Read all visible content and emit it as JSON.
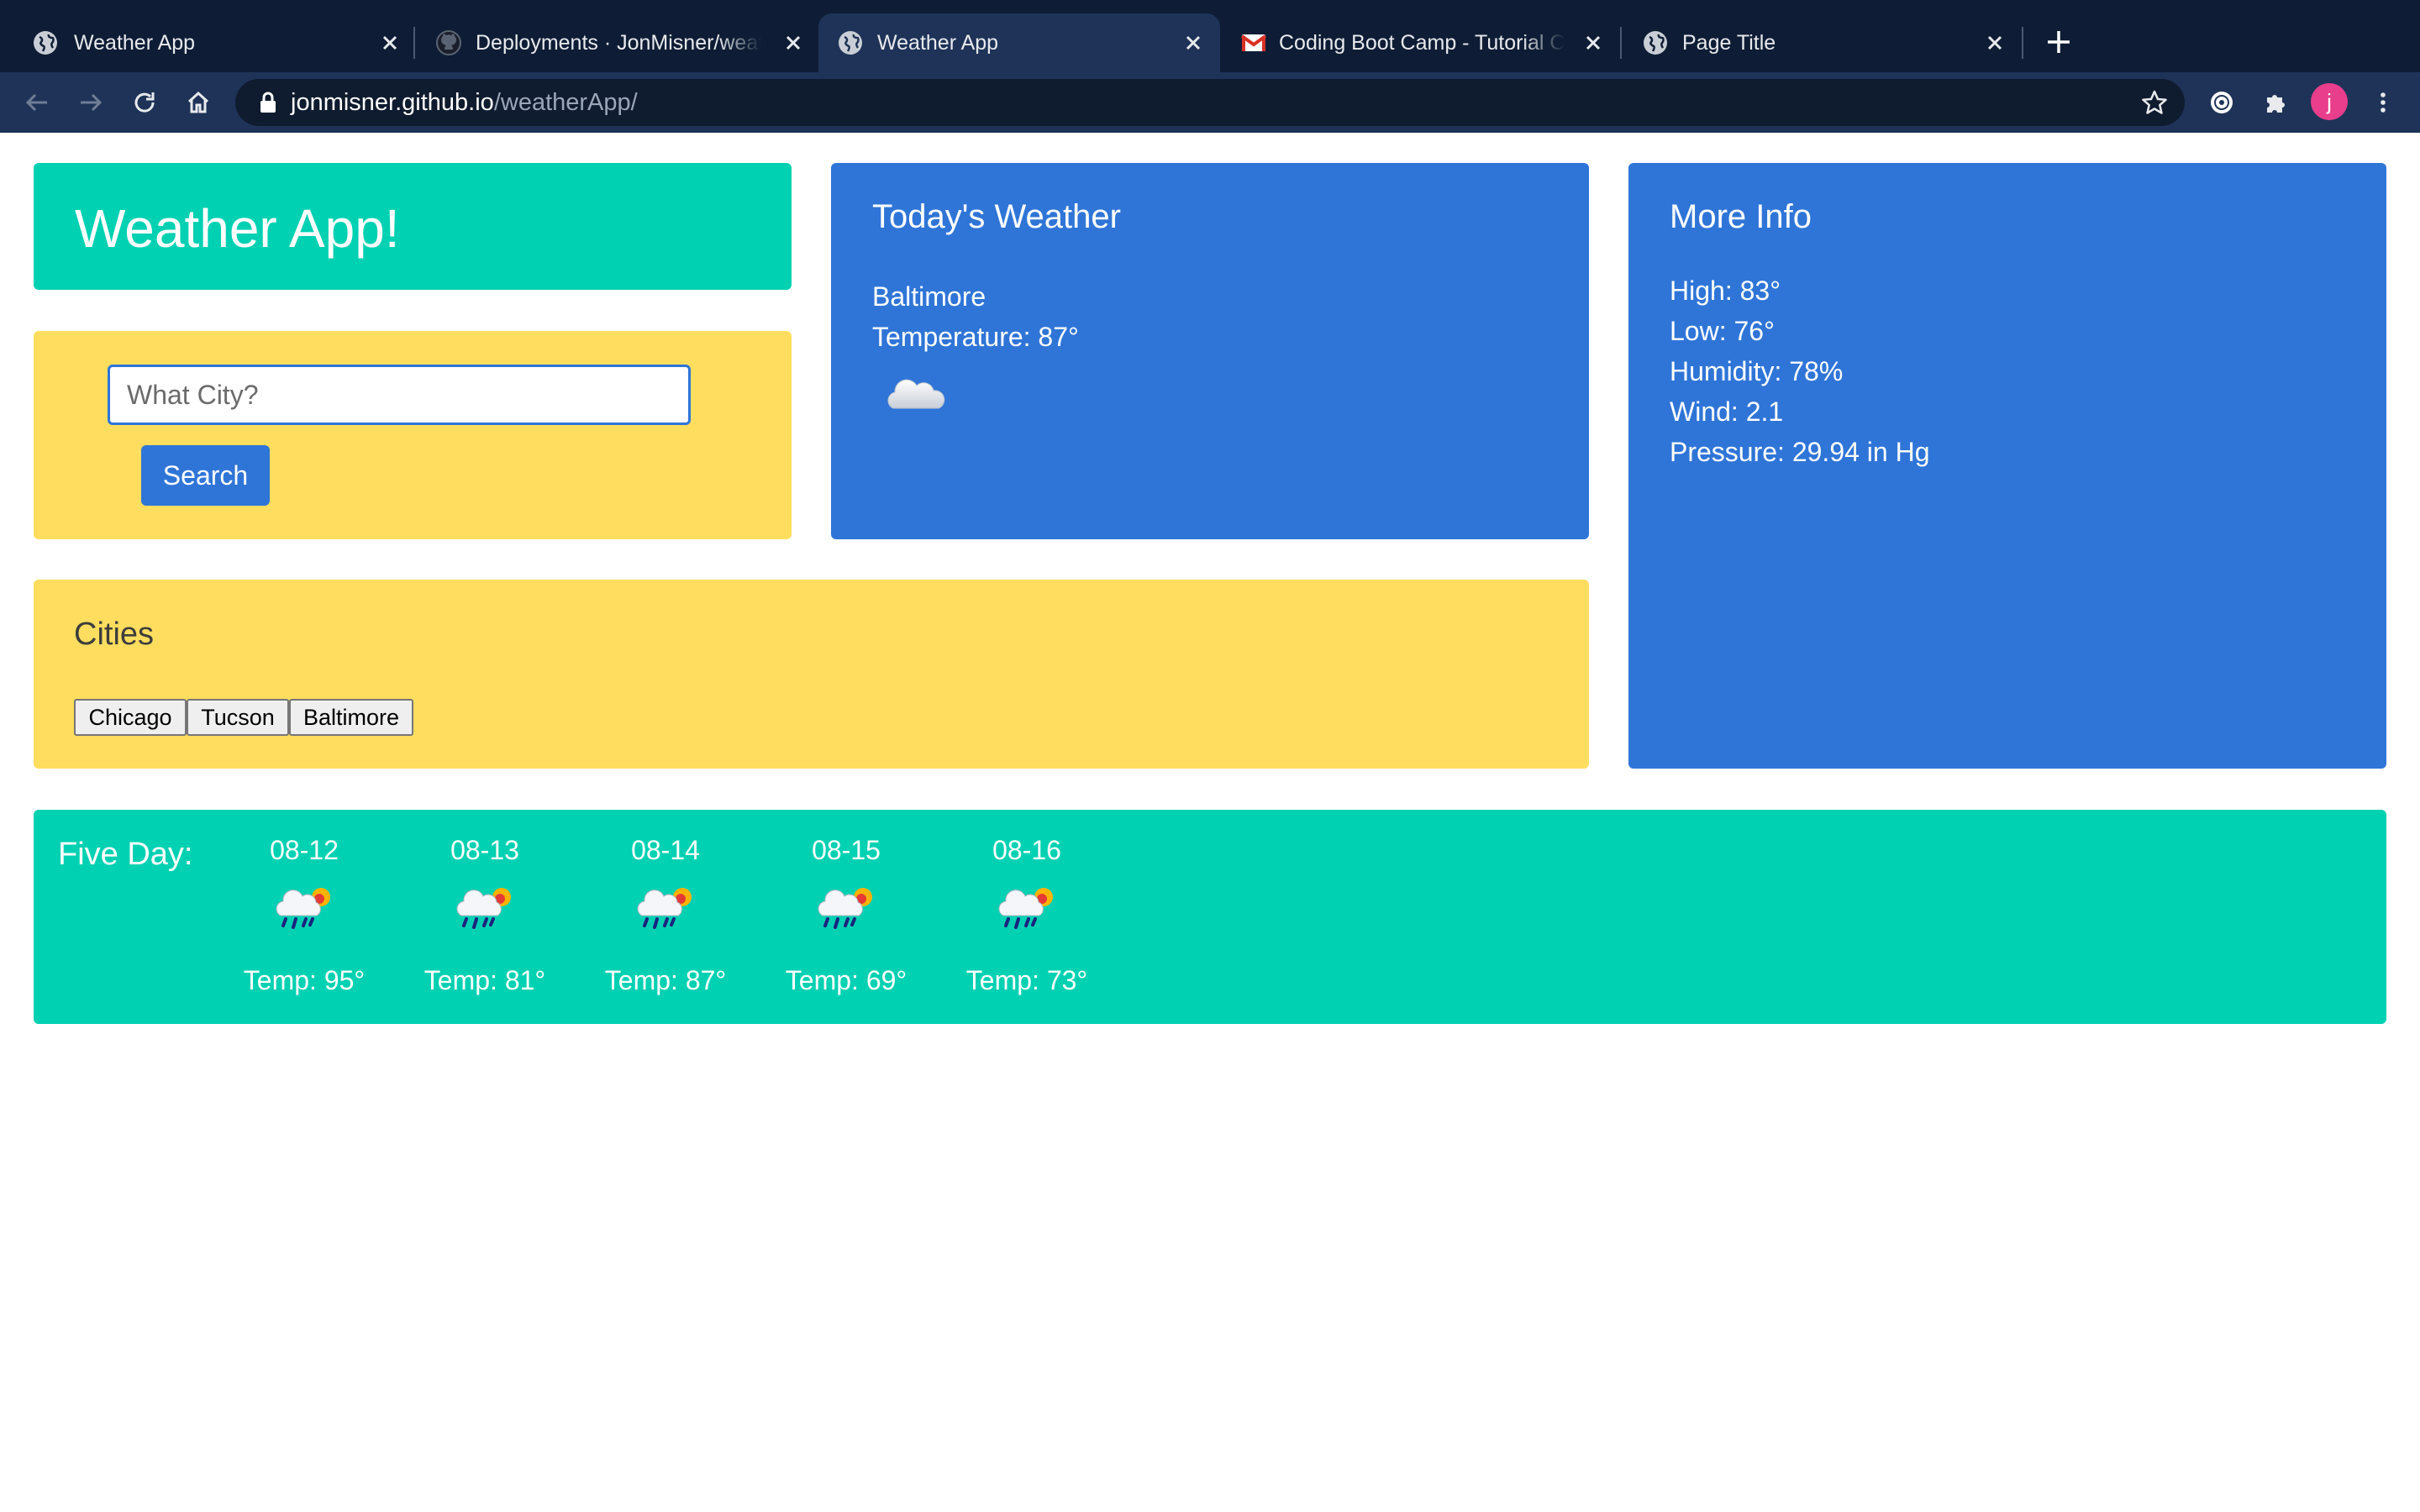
{
  "browser": {
    "tabs": [
      {
        "title": "Weather App",
        "icon": "globe-icon",
        "active": false
      },
      {
        "title": "Deployments · JonMisner/weatherApp",
        "icon": "github-icon",
        "active": false
      },
      {
        "title": "Weather App",
        "icon": "globe-icon",
        "active": true
      },
      {
        "title": "Coding Boot Camp - Tutorial Calendar",
        "icon": "gmail-icon",
        "active": false
      },
      {
        "title": "Page Title",
        "icon": "globe-icon",
        "active": false
      }
    ],
    "url": {
      "host": "jonmisner.github.io",
      "path": "/weatherApp/"
    },
    "profile_initial": "j"
  },
  "app": {
    "title": "Weather App!",
    "search": {
      "placeholder": "What City?",
      "value": "",
      "button_label": "Search"
    },
    "today": {
      "heading": "Today's Weather",
      "city": "Baltimore",
      "temperature": "Temperature: 87°",
      "icon": "cloud-icon"
    },
    "more_info": {
      "heading": "More Info",
      "lines": [
        "High: 83°",
        "Low: 76°",
        "Humidity: 78%",
        "Wind: 2.1",
        "Pressure: 29.94 in Hg"
      ]
    },
    "cities": {
      "heading": "Cities",
      "buttons": [
        "Chicago",
        "Tucson",
        "Baltimore"
      ]
    },
    "five_day": {
      "heading": "Five Day:",
      "days": [
        {
          "date": "08-12",
          "temp": "Temp: 95°",
          "icon": "rain-sun-icon"
        },
        {
          "date": "08-13",
          "temp": "Temp: 81°",
          "icon": "rain-sun-icon"
        },
        {
          "date": "08-14",
          "temp": "Temp: 87°",
          "icon": "rain-sun-icon"
        },
        {
          "date": "08-15",
          "temp": "Temp: 69°",
          "icon": "rain-sun-icon"
        },
        {
          "date": "08-16",
          "temp": "Temp: 73°",
          "icon": "rain-sun-icon"
        }
      ]
    }
  },
  "colors": {
    "teal": "#00d1b2",
    "yellow": "#ffdd5f",
    "blue": "#2f75d8",
    "chrome_dark": "#0e1d35",
    "chrome_toolbar": "#1e3357"
  }
}
